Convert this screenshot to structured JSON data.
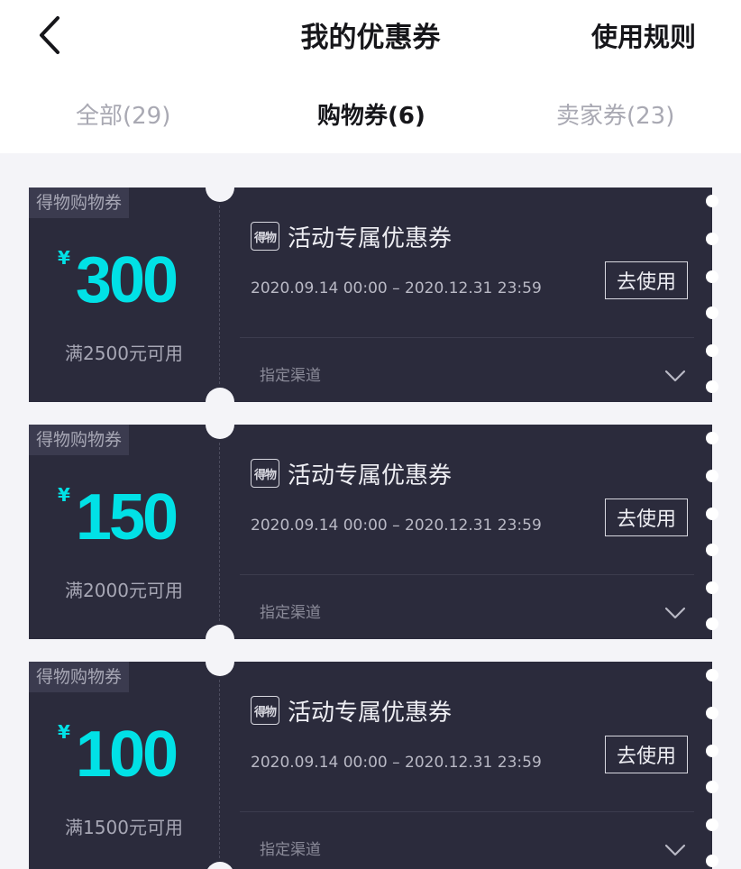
{
  "header": {
    "title": "我的优惠券",
    "rules_label": "使用规则"
  },
  "tabs": [
    {
      "label": "全部(29)",
      "active": false
    },
    {
      "label": "购物券(6)",
      "active": true
    },
    {
      "label": "卖家券(23)",
      "active": false
    }
  ],
  "coupons": [
    {
      "tag": "得物购物券",
      "currency": "¥",
      "amount": "300",
      "condition": "满2500元可用",
      "logo_text": "得物",
      "title": "活动专属优惠券",
      "validity": "2020.09.14 00:00 – 2020.12.31 23:59",
      "use_label": "去使用",
      "channel": "指定渠道"
    },
    {
      "tag": "得物购物券",
      "currency": "¥",
      "amount": "150",
      "condition": "满2000元可用",
      "logo_text": "得物",
      "title": "活动专属优惠券",
      "validity": "2020.09.14 00:00 – 2020.12.31 23:59",
      "use_label": "去使用",
      "channel": "指定渠道"
    },
    {
      "tag": "得物购物券",
      "currency": "¥",
      "amount": "100",
      "condition": "满1500元可用",
      "logo_text": "得物",
      "title": "活动专属优惠券",
      "validity": "2020.09.14 00:00 – 2020.12.31 23:59",
      "use_label": "去使用",
      "channel": "指定渠道"
    }
  ],
  "icons": {
    "back": "chevron-left-icon",
    "expand": "chevron-down-icon",
    "logo": "dewu-logo-icon"
  },
  "colors": {
    "accent": "#01e1e6",
    "card_bg": "#2b2b3c",
    "page_bg": "#f4f4f8"
  }
}
